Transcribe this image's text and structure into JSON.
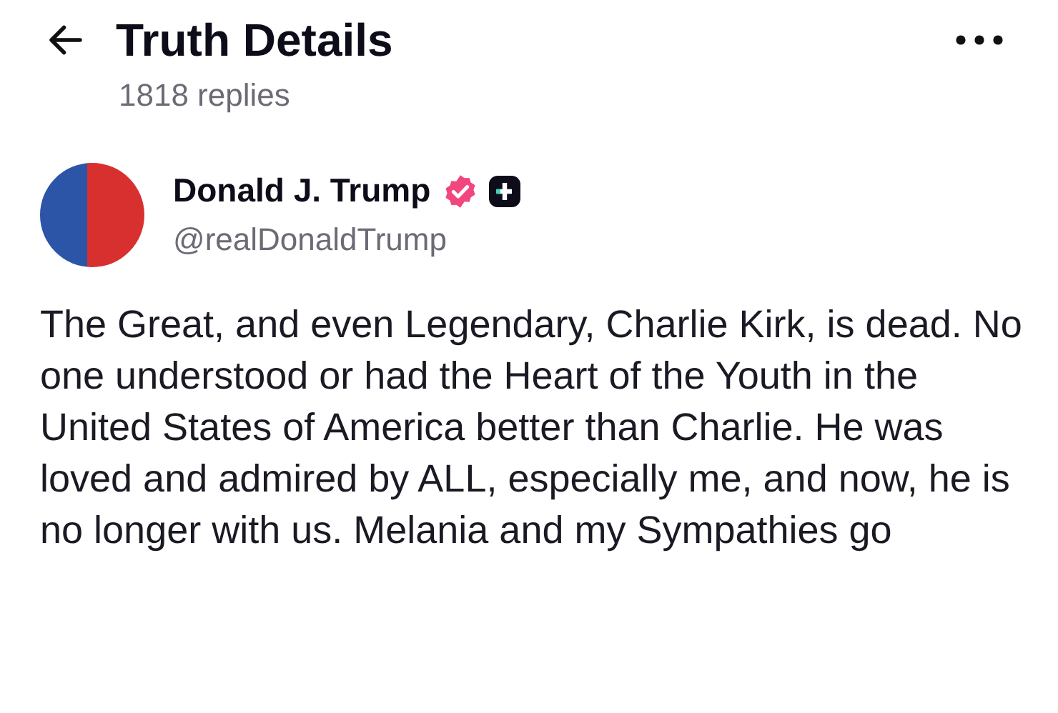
{
  "header": {
    "title": "Truth Details",
    "subtitle": "1818 replies"
  },
  "author": {
    "name": "Donald J. Trump",
    "handle": "@realDonaldTrump",
    "verified": true
  },
  "post": {
    "text": "The Great, and even Legendary, Charlie Kirk, is dead. No one understood or had the Heart of the Youth in the United States of America better than Charlie. He was loved and admired by ALL, especially me, and now, he is no longer with us. Melania and my Sympathies go"
  }
}
